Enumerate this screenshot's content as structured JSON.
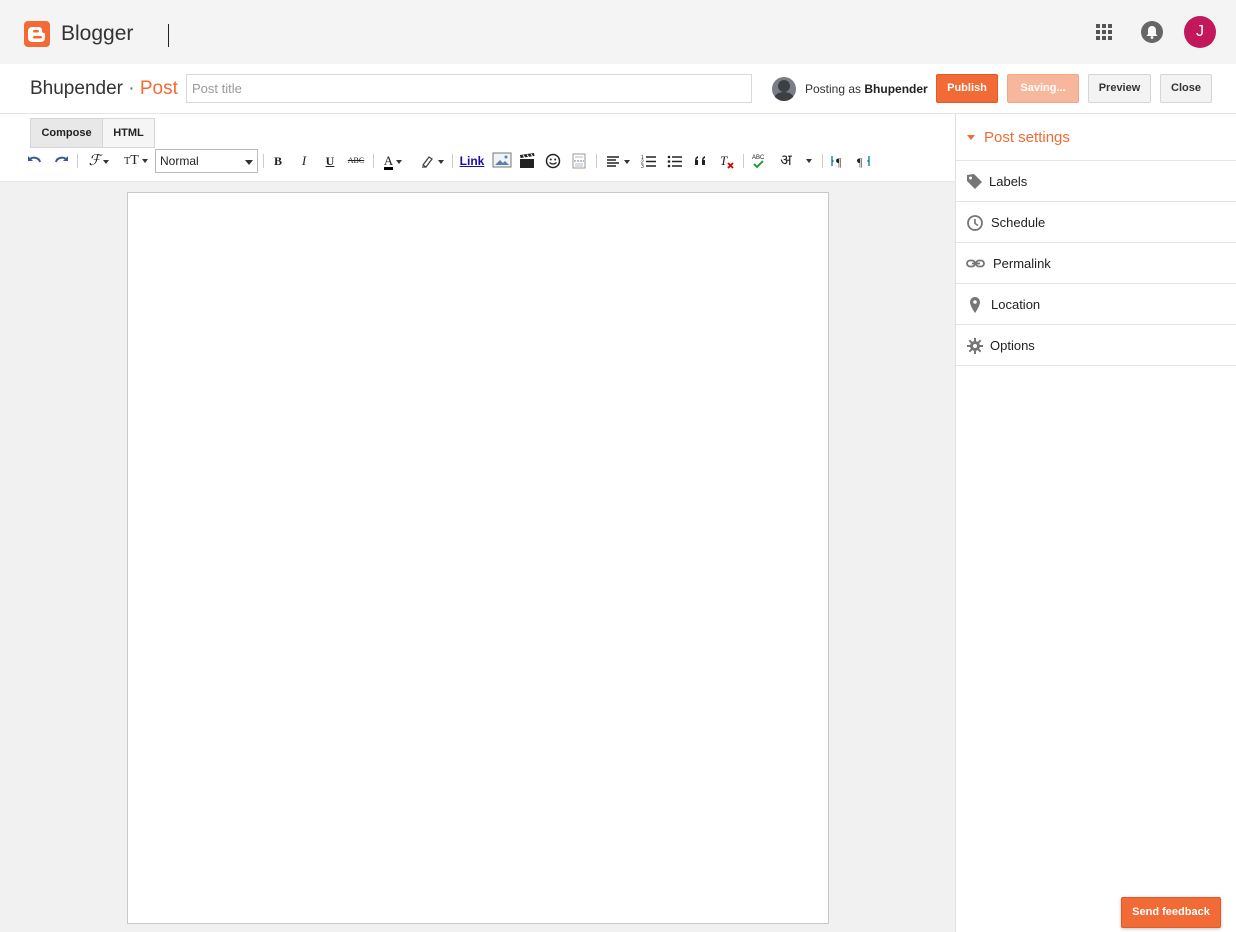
{
  "header": {
    "brand": "Blogger",
    "avatar_letter": "J",
    "accent": "#f26a35",
    "avatar_color": "#c2185b"
  },
  "postbar": {
    "blog_name": "Bhupender",
    "separator": "·",
    "section": "Post",
    "title_placeholder": "Post title",
    "title_value": "",
    "posting_as_prefix": "Posting as",
    "posting_as_user": "Bhupender",
    "publish": "Publish",
    "saving": "Saving...",
    "preview": "Preview",
    "close": "Close"
  },
  "editor": {
    "tabs": [
      "Compose",
      "HTML"
    ],
    "format_select": "Normal",
    "link_label": "Link",
    "bold": "B",
    "italic": "I",
    "underline": "U",
    "strike": "ABC",
    "text_color": "A",
    "hindi": "अ",
    "toolbar_icons": [
      "undo-icon",
      "redo-icon",
      "font-family-icon",
      "font-size-icon",
      "bold-icon",
      "italic-icon",
      "underline-icon",
      "strikethrough-icon",
      "text-color-icon",
      "highlight-icon",
      "link-icon",
      "image-icon",
      "video-icon",
      "emoji-icon",
      "jump-break-icon",
      "align-icon",
      "numbered-list-icon",
      "bullet-list-icon",
      "quote-icon",
      "remove-format-icon",
      "spellcheck-icon",
      "transliterate-icon",
      "ltr-icon",
      "rtl-icon"
    ]
  },
  "sidebar": {
    "heading": "Post settings",
    "items": [
      {
        "label": "Labels",
        "icon": "tag-icon"
      },
      {
        "label": "Schedule",
        "icon": "clock-icon"
      },
      {
        "label": "Permalink",
        "icon": "link-icon"
      },
      {
        "label": "Location",
        "icon": "pin-icon"
      },
      {
        "label": "Options",
        "icon": "gear-icon"
      }
    ]
  },
  "feedback": "Send feedback"
}
